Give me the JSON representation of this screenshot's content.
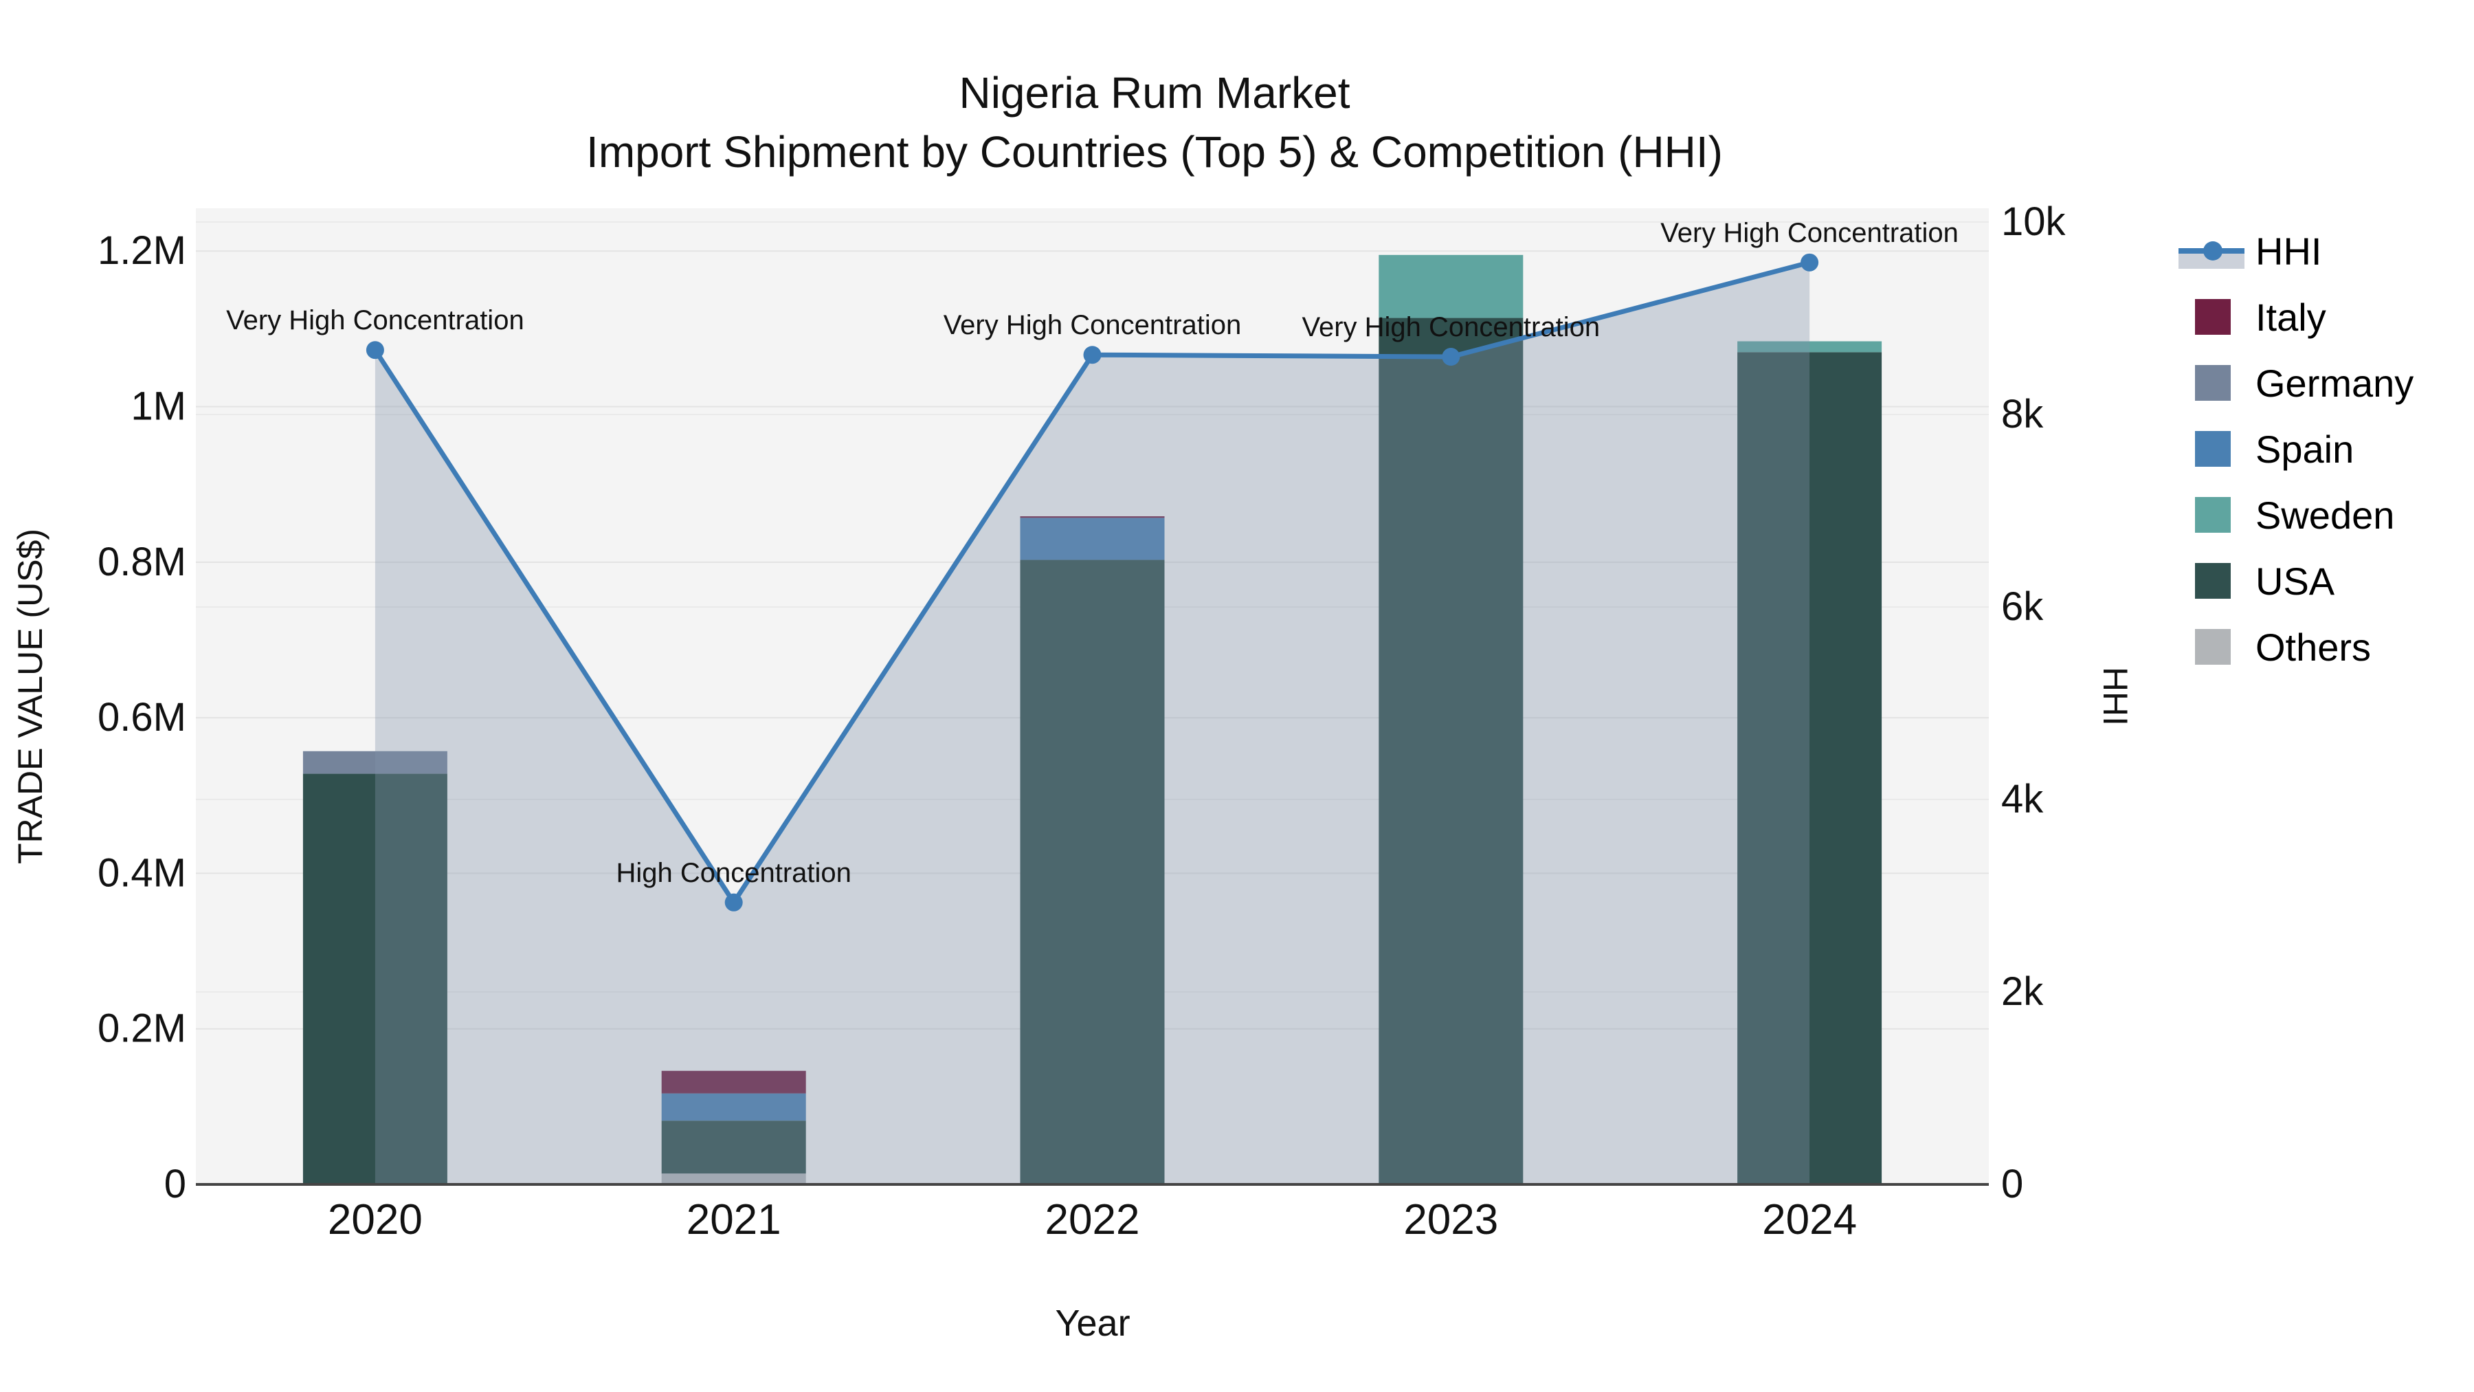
{
  "title": {
    "line1": "Nigeria Rum Market",
    "line2": "Import Shipment by Countries (Top 5) & Competition (HHI)"
  },
  "axes": {
    "x": {
      "title": "Year",
      "tick_labels": [
        "2020",
        "2021",
        "2022",
        "2023",
        "2024"
      ]
    },
    "left": {
      "title": "TRADE VALUE (US$)",
      "tick_labels": [
        "0",
        "0.2M",
        "0.4M",
        "0.6M",
        "0.8M",
        "1M",
        "1.2M"
      ],
      "tick_values": [
        0,
        200000,
        400000,
        600000,
        800000,
        1000000,
        1200000
      ],
      "max": 1255000
    },
    "right": {
      "title": "HHI",
      "tick_labels": [
        "0",
        "2k",
        "4k",
        "6k",
        "8k",
        "10k"
      ],
      "tick_values": [
        0,
        2000,
        4000,
        6000,
        8000,
        10000
      ],
      "max": 10143
    }
  },
  "chart_data": {
    "type": "bar+line",
    "title": "Nigeria Rum Market — Import Shipment by Countries (Top 5) & Competition (HHI)",
    "xlabel": "Year",
    "ylabel_left": "TRADE VALUE (US$)",
    "ylabel_right": "HHI",
    "ylim_left": [
      0,
      1255000
    ],
    "ylim_right": [
      0,
      10143
    ],
    "grid": true,
    "legend_position": "right",
    "categories": [
      "2020",
      "2021",
      "2022",
      "2023",
      "2024"
    ],
    "bar_mode": "stacked",
    "stack_order_bottom_to_top": [
      "Others",
      "USA",
      "Sweden",
      "Spain",
      "Germany",
      "Italy"
    ],
    "series": [
      {
        "name": "Italy",
        "type": "bar",
        "color": "#701f42",
        "values": [
          0,
          29000,
          2000,
          0,
          0
        ]
      },
      {
        "name": "Germany",
        "type": "bar",
        "color": "#75849b",
        "values": [
          29000,
          0,
          0,
          0,
          0
        ]
      },
      {
        "name": "Spain",
        "type": "bar",
        "color": "#4a80b2",
        "values": [
          0,
          35000,
          54000,
          0,
          0
        ]
      },
      {
        "name": "Sweden",
        "type": "bar",
        "color": "#5fa5a0",
        "values": [
          0,
          0,
          0,
          81000,
          14000
        ]
      },
      {
        "name": "USA",
        "type": "bar",
        "color": "#30504e",
        "values": [
          528000,
          68000,
          803000,
          1114000,
          1070000
        ]
      },
      {
        "name": "Others",
        "type": "bar",
        "color": "#b2b5b8",
        "values": [
          0,
          14000,
          0,
          0,
          0
        ]
      }
    ],
    "line_series": {
      "name": "HHI",
      "type": "line+area",
      "axis": "right",
      "color": "#3e7cb6",
      "area_fill": "rgba(130,145,170,0.35)",
      "values": [
        8670,
        2930,
        8620,
        8600,
        9580
      ]
    },
    "annotations": [
      {
        "category": "2020",
        "text": "Very High Concentration"
      },
      {
        "category": "2021",
        "text": "High Concentration"
      },
      {
        "category": "2022",
        "text": "Very High Concentration"
      },
      {
        "category": "2023",
        "text": "Very High Concentration"
      },
      {
        "category": "2024",
        "text": "Very High Concentration"
      }
    ]
  },
  "legend": {
    "entries": [
      "HHI",
      "Italy",
      "Germany",
      "Spain",
      "Sweden",
      "USA",
      "Others"
    ]
  },
  "style": {
    "plot_bg": "#f4f4f4",
    "grid_color_left": "#e3e3e3",
    "grid_color_right": "#eaeaea",
    "axis_line_color": "#444444",
    "text_color": "#111111"
  }
}
